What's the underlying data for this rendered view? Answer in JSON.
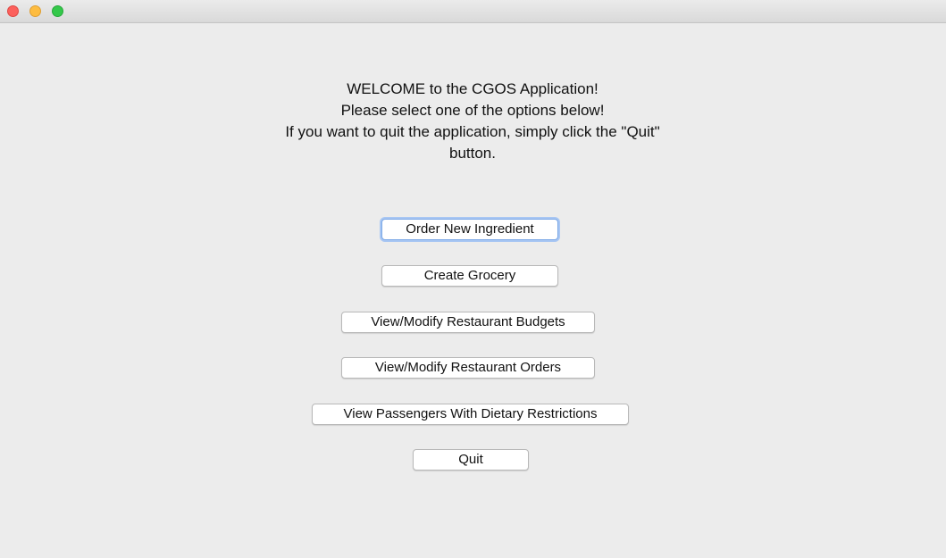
{
  "window": {
    "controls": [
      "close",
      "minimize",
      "zoom"
    ]
  },
  "message": {
    "line1": "WELCOME to the CGOS Application!",
    "line2": "Please select one of the options below!",
    "line3": "If you want to quit the application, simply click the \"Quit\"",
    "line4": "button."
  },
  "buttons": [
    {
      "label": "Order New Ingredient",
      "focused": true
    },
    {
      "label": "Create Grocery"
    },
    {
      "label": "View/Modify Restaurant Budgets"
    },
    {
      "label": "View/Modify Restaurant Orders"
    },
    {
      "label": "View Passengers With Dietary Restrictions"
    },
    {
      "label": "Quit"
    }
  ]
}
